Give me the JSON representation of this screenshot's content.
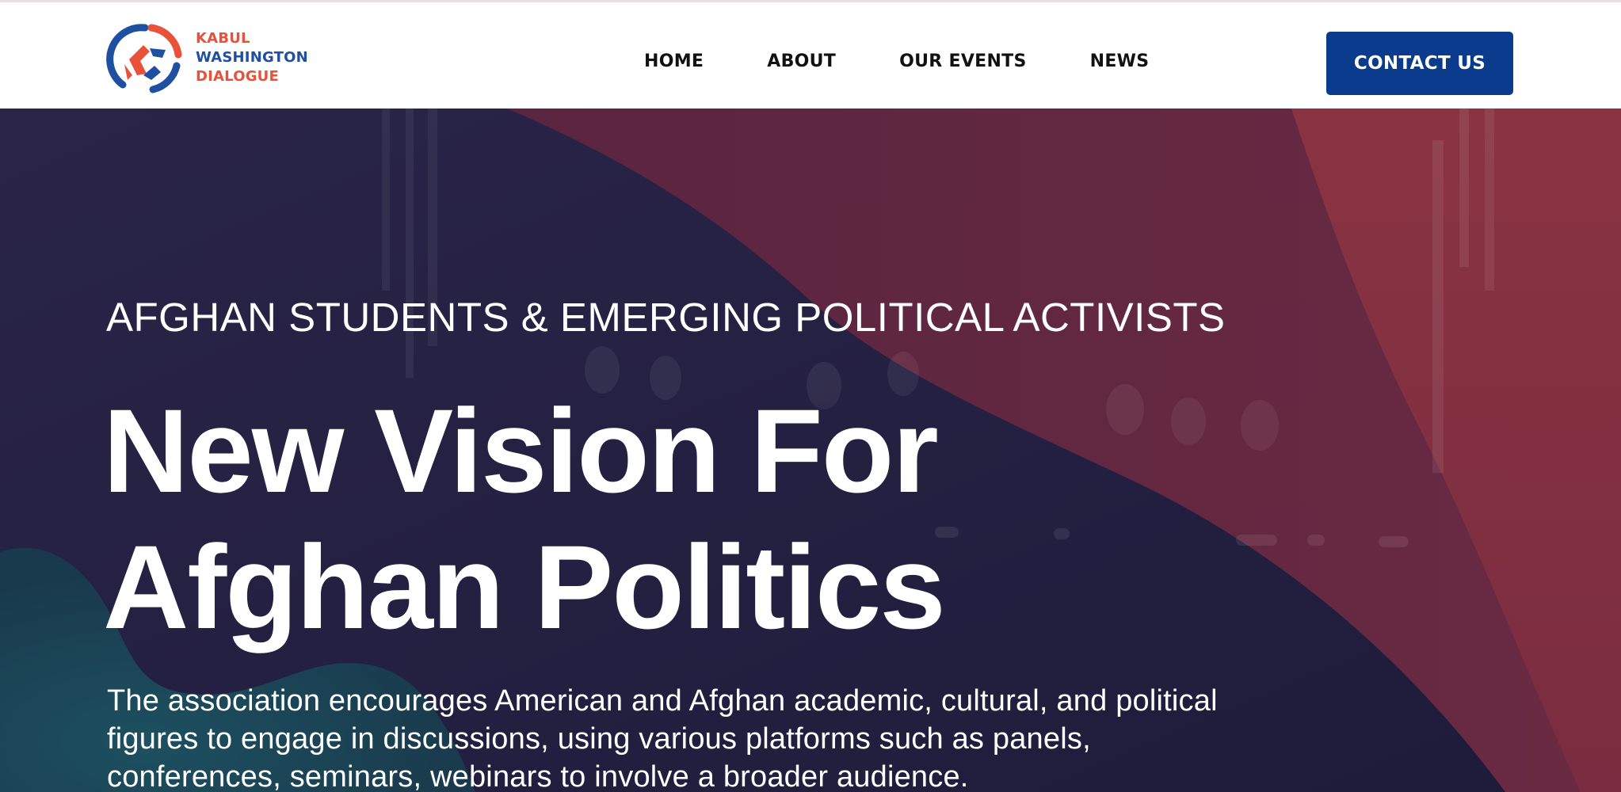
{
  "brand": {
    "logo_line1": "KABUL",
    "logo_line2": "WASHINGTON",
    "logo_line3": "DIALOGUE",
    "colors": {
      "orange": "#e8513a",
      "blue": "#1f4fa0",
      "button": "#0b3b8c"
    }
  },
  "nav": {
    "items": [
      {
        "label": "HOME"
      },
      {
        "label": "ABOUT"
      },
      {
        "label": "OUR EVENTS"
      },
      {
        "label": "NEWS"
      }
    ],
    "cta_label": "CONTACT US"
  },
  "hero": {
    "kicker": "AFGHAN STUDENTS & EMERGING POLITICAL ACTIVISTS",
    "headline_line1": "New Vision For",
    "headline_line2": "Afghan Politics",
    "lead": "The association encourages American and Afghan academic, cultural, and political figures to engage in discussions, using various platforms such as panels, conferences, seminars, webinars to involve a broader audience.",
    "colors": {
      "navy": "#231f40",
      "crimson": "#5e2740",
      "red": "#8a3340",
      "teal": "#1c4454"
    }
  }
}
